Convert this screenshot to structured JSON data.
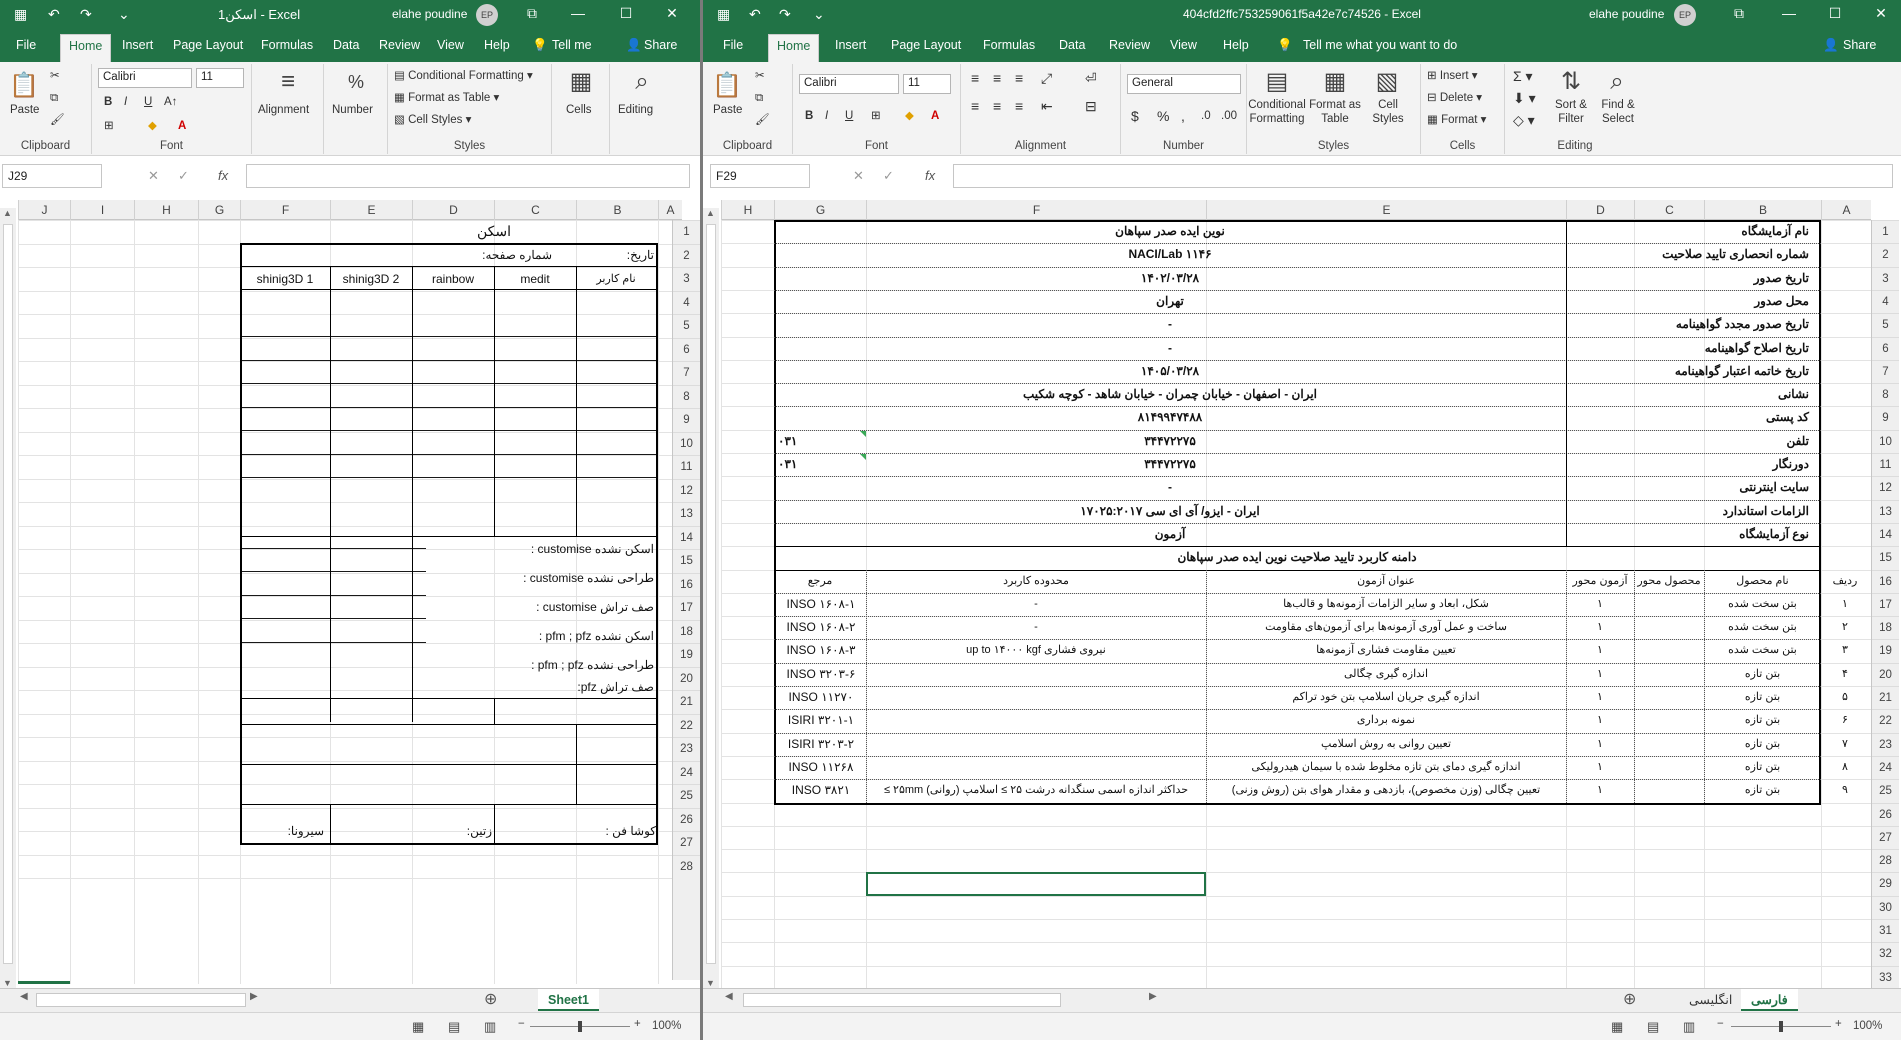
{
  "left": {
    "title": "اسکن1  -  Excel",
    "user": "elahe poudine",
    "avatar": "EP",
    "tabs": [
      "File",
      "Home",
      "Insert",
      "Page Layout",
      "Formulas",
      "Data",
      "Review",
      "View",
      "Help"
    ],
    "tell_me": "Tell me",
    "share": "Share",
    "font_name": "Calibri",
    "font_size": "11",
    "groups": {
      "clipboard": "Clipboard",
      "font": "Font",
      "alignment": "Alignment",
      "number": "Number",
      "styles": "Styles",
      "cells": "Cells",
      "editing": "Editing"
    },
    "paste": "Paste",
    "cond_format": "Conditional Formatting",
    "format_table": "Format as Table",
    "cell_styles": "Cell Styles",
    "name_box": "J29",
    "fx": "fx",
    "columns": [
      "J",
      "I",
      "H",
      "G",
      "F",
      "E",
      "D",
      "C",
      "B",
      "A"
    ],
    "rows": [
      "1",
      "2",
      "3",
      "4",
      "5",
      "6",
      "7",
      "8",
      "9",
      "10",
      "11",
      "12",
      "13",
      "14",
      "15",
      "16",
      "17",
      "18",
      "19",
      "20",
      "21",
      "22",
      "23",
      "24",
      "25",
      "26",
      "27",
      "28"
    ],
    "sheet": {
      "title": "اسکن",
      "date_label": "تاریخ:",
      "page_no_label": "شماره صفحه:",
      "username": "نام کاربر",
      "medit": "medit",
      "rainbow": "rainbow",
      "shining2": "shinig3D 2",
      "shining1": "shinig3D 1",
      "r12": "اسکن نشده customise :",
      "r13": "طراحی نشده customise :",
      "r14": "صف تراش customise :",
      "r15": "اسکن نشده pfm ; pfz :",
      "r16": "طراحی نشده pfm ; pfz :",
      "r17": "صف تراش pfz:",
      "r22a": "کوشا فن :",
      "r22b": "زتین:",
      "r22c": "سیرونا:"
    },
    "sheet_tab": "Sheet1",
    "zoom": "100%"
  },
  "right": {
    "title": "404cfd2ffc753259061f5a42e7c74526  -  Excel",
    "user": "elahe poudine",
    "avatar": "EP",
    "tabs": [
      "File",
      "Home",
      "Insert",
      "Page Layout",
      "Formulas",
      "Data",
      "Review",
      "View",
      "Help"
    ],
    "tell_me": "Tell me what you want to do",
    "share": "Share",
    "font_name": "Calibri",
    "font_size": "11",
    "number_format": "General",
    "groups": {
      "clipboard": "Clipboard",
      "font": "Font",
      "alignment": "Alignment",
      "number": "Number",
      "styles": "Styles",
      "cells": "Cells",
      "editing": "Editing"
    },
    "paste": "Paste",
    "cond_format": [
      "Conditional",
      "Formatting"
    ],
    "format_table": [
      "Format as",
      "Table"
    ],
    "cell_styles": [
      "Cell",
      "Styles"
    ],
    "insert": "Insert",
    "delete": "Delete",
    "format": "Format",
    "sort": [
      "Sort &",
      "Filter"
    ],
    "find": [
      "Find &",
      "Select"
    ],
    "name_box": "F29",
    "fx": "fx",
    "columns": [
      "H",
      "G",
      "F",
      "E",
      "D",
      "C",
      "B",
      "A"
    ],
    "rows": [
      "1",
      "2",
      "3",
      "4",
      "5",
      "6",
      "7",
      "8",
      "9",
      "10",
      "11",
      "12",
      "13",
      "14",
      "15",
      "16",
      "17",
      "18",
      "19",
      "20",
      "21",
      "22",
      "23",
      "24",
      "25",
      "26",
      "27",
      "28",
      "29",
      "30",
      "31",
      "32",
      "33"
    ],
    "info": [
      {
        "label": "نام آزمایشگاه",
        "value": "نوین ایده صدر سپاهان"
      },
      {
        "label": "شماره انحصاری تایید صلاحیت",
        "value": "NACI/Lab ۱۱۴۶"
      },
      {
        "label": "تاریخ صدور",
        "value": "۱۴۰۲/۰۳/۲۸"
      },
      {
        "label": "محل صدور",
        "value": "تهران"
      },
      {
        "label": "تاریخ صدور مجدد گواهینامه",
        "value": "-"
      },
      {
        "label": "تاریخ اصلاح گواهینامه",
        "value": "-"
      },
      {
        "label": "تاریخ خاتمه اعتبار گواهینامه",
        "value": "۱۴۰۵/۰۳/۲۸"
      },
      {
        "label": "نشانی",
        "value": "ایران - اصفهان - خیابان چمران - خیابان شاهد - کوچه شکیب"
      },
      {
        "label": "کد پستی",
        "value": "۸۱۴۹۹۴۷۴۸۸"
      },
      {
        "label": "تلفن",
        "value": "۳۴۴۷۲۲۷۵",
        "extra": "۰۳۱"
      },
      {
        "label": "دورنگار",
        "value": "۳۴۴۷۲۲۷۵",
        "extra": "۰۳۱"
      },
      {
        "label": "سایت اینترنتی",
        "value": "-"
      },
      {
        "label": "الزامات استاندارد",
        "value": "ایران - ایزو/ آی ای سی ۱۷۰۲۵:۲۰۱۷"
      },
      {
        "label": "نوع آزمایشگاه",
        "value": "آزمون"
      }
    ],
    "scope_title": "دامنه کاربرد تایید صلاحیت نوین ایده صدر سپاهان",
    "headers": {
      "row": "ردیف",
      "product": "نام محصول",
      "axis_product": "محصول محور",
      "axis_test": "آزمون محور",
      "test": "عنوان آزمون",
      "range": "محدوده کاربرد",
      "ref": "مرجع"
    },
    "tests": [
      {
        "n": "۱",
        "product": "بتن سخت شده",
        "axis": "۱",
        "test": "شکل، ابعاد و سایر الزامات آزمونه‌ها و قالب‌ها",
        "range": "-",
        "ref": "INSO ۱۶۰۸-۱"
      },
      {
        "n": "۲",
        "product": "بتن سخت شده",
        "axis": "۱",
        "test": "ساخت و عمل آوری آزمونه‌ها برای آزمون‌های مقاومت",
        "range": "-",
        "ref": "INSO ۱۶۰۸-۲"
      },
      {
        "n": "۳",
        "product": "بتن سخت شده",
        "axis": "۱",
        "test": "تعیین مقاومت فشاری آزمونه‌ها",
        "range": "نیروی فشاری up to ۱۴۰۰۰ kgf",
        "ref": "INSO ۱۶۰۸-۳"
      },
      {
        "n": "۴",
        "product": "بتن تازه",
        "axis": "۱",
        "test": "اندازه گیری چگالی",
        "range": "",
        "ref": "INSO ۳۲۰۳-۶"
      },
      {
        "n": "۵",
        "product": "بتن تازه",
        "axis": "۱",
        "test": "اندازه گیری جریان اسلامپ بتن خود تراکم",
        "range": "",
        "ref": "INSO ۱۱۲۷۰"
      },
      {
        "n": "۶",
        "product": "بتن تازه",
        "axis": "۱",
        "test": "نمونه برداری",
        "range": "",
        "ref": "ISIRI ۳۲۰۱-۱"
      },
      {
        "n": "۷",
        "product": "بتن تازه",
        "axis": "۱",
        "test": "تعیین روانی به روش اسلامپ",
        "range": "",
        "ref": "ISIRI ۳۲۰۳-۲"
      },
      {
        "n": "۸",
        "product": "بتن تازه",
        "axis": "۱",
        "test": "اندازه گیری دمای بتن تازه مخلوط شده با سیمان هیدرولیکی",
        "range": "",
        "ref": "INSO ۱۱۲۶۸"
      },
      {
        "n": "۹",
        "product": "بتن تازه",
        "axis": "۱",
        "test": "تعیین چگالی (وزن مخصوص)، بازدهی و مقدار هوای بتن (روش وزنی)",
        "range": "حداکثر اندازه اسمی سنگدانه درشت ۲۵ ≥ اسلامپ (روانی) ۲۵mm ≥",
        "ref": "INSO ۳۸۲۱"
      }
    ],
    "sheet_tabs": [
      "انگلیسی",
      "فارسی"
    ],
    "zoom": "100%"
  }
}
